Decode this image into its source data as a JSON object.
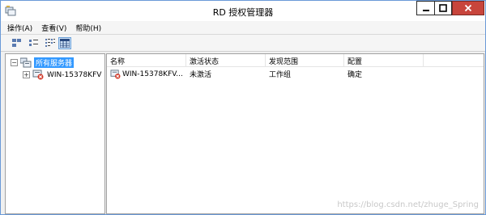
{
  "window": {
    "title": "RD 授权管理器"
  },
  "menu": [
    {
      "label": "操作(A)"
    },
    {
      "label": "查看(V)"
    },
    {
      "label": "帮助(H)"
    }
  ],
  "toolbar": {
    "buttons": [
      "large-icons-view",
      "small-icons-view",
      "list-view",
      "details-view"
    ],
    "active": "details-view"
  },
  "tree": {
    "root_label": "所有服务器",
    "child_label": "WIN-15378KFV"
  },
  "list": {
    "columns": [
      "名称",
      "激活状态",
      "发现范围",
      "配置"
    ],
    "rows": [
      {
        "name": "WIN-15378KFV...",
        "status": "未激活",
        "scope": "工作组",
        "config": "确定"
      }
    ]
  },
  "watermark": "https://blog.csdn.net/zhuge_Spring",
  "colors": {
    "close_button": "#c8453c",
    "selection": "#3399ff",
    "accent_border": "#6a9ad8"
  }
}
